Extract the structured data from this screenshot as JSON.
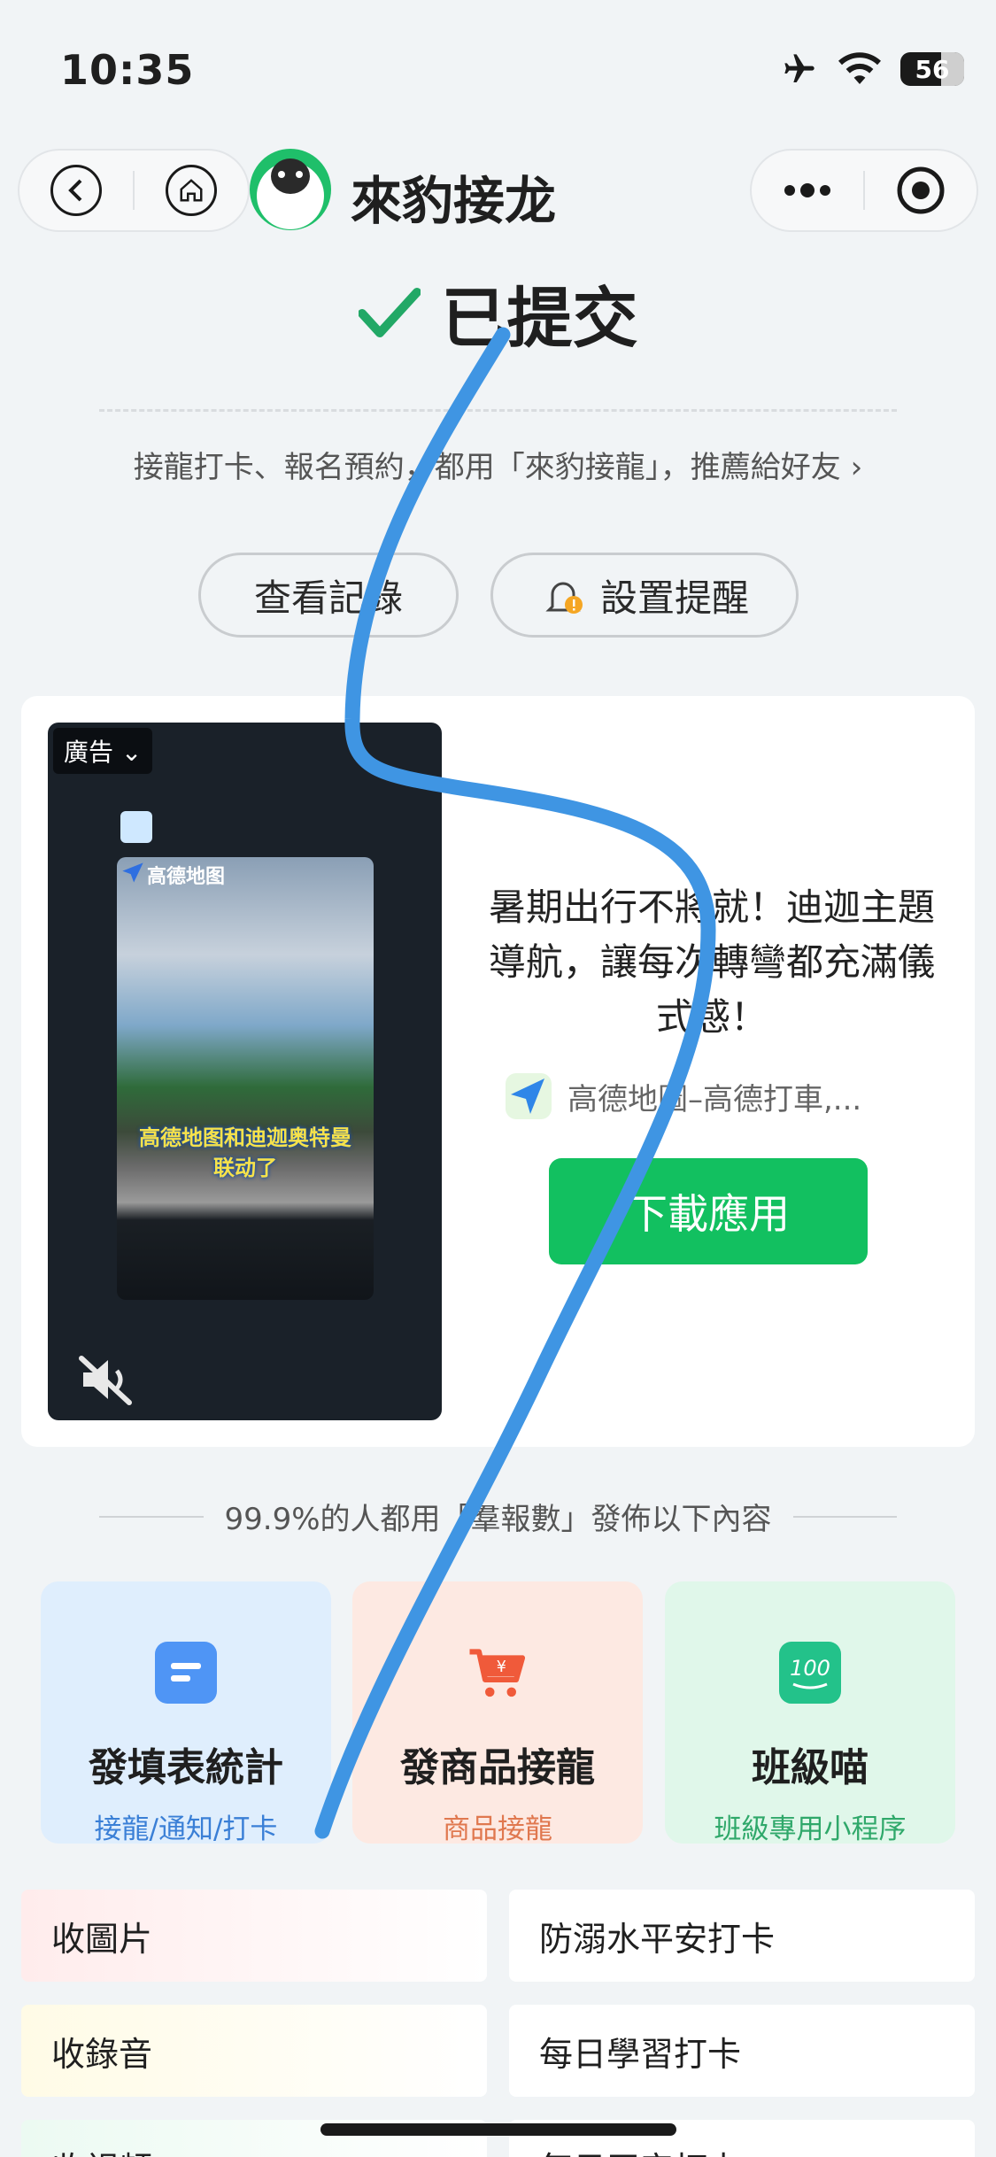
{
  "status_bar": {
    "time": "10:35",
    "battery": "56"
  },
  "header": {
    "app_title": "來豹接龙"
  },
  "result": {
    "title": "已提交",
    "promo": "接龍打卡、報名預約，都用「來豹接龍」，推薦給好友 ›",
    "view_records": "查看記錄",
    "set_reminder": "設置提醒"
  },
  "ad": {
    "label": "廣告",
    "inner_title": "高德地图",
    "caption_line1": "高德地图和迪迦奥特曼",
    "caption_line2": "联动了",
    "headline": "暑期出行不將就！迪迦主題導航，讓每次轉彎都充滿儀式感！",
    "app_name": "高德地圖–高德打車,...",
    "download": "下載應用"
  },
  "section_heading": "99.9%的人都用「羣報數」發佈以下內容",
  "features": [
    {
      "title": "發填表統計",
      "subtitle": "接龍/通知/打卡",
      "bg": "#dfeefd",
      "sub_color": "#3a7fd6",
      "icon_color": "#4f95f5"
    },
    {
      "title": "發商品接龍",
      "subtitle": "商品接龍",
      "bg": "#fde9e2",
      "sub_color": "#e0784f",
      "icon_color": "#f05a3a"
    },
    {
      "title": "班級喵",
      "subtitle": "班級專用小程序",
      "bg": "#e0f7ea",
      "sub_color": "#2fa86a",
      "icon_color": "#23c28a"
    }
  ],
  "tiles": [
    "收圖片",
    "防溺水平安打卡",
    "收錄音",
    "每日學習打卡",
    "收視頻",
    "每日平安打卡"
  ],
  "colors": {
    "accent_green": "#12c060",
    "stroke_blue": "#3f95e3"
  }
}
